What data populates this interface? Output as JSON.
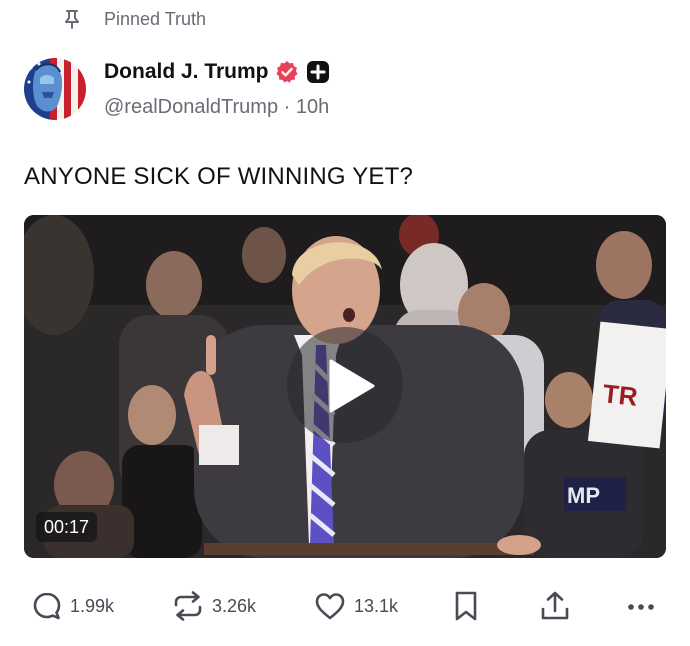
{
  "pinned": {
    "label": "Pinned Truth",
    "icon": "pin-icon"
  },
  "author": {
    "display_name": "Donald J. Trump",
    "handle": "@realDonaldTrump",
    "separator": "·",
    "time_ago": "10h",
    "verified_icon": "verified-badge-icon",
    "verified_color": "#e8415a",
    "badge_icon": "plus-badge-icon"
  },
  "post": {
    "text": "ANYONE SICK OF WINNING YET?"
  },
  "video": {
    "duration": "00:17",
    "play_icon": "play-icon"
  },
  "actions": {
    "replies": {
      "icon": "reply-icon",
      "count": "1.99k"
    },
    "retruths": {
      "icon": "retruth-icon",
      "count": "3.26k"
    },
    "likes": {
      "icon": "heart-icon",
      "count": "13.1k"
    },
    "bookmark": {
      "icon": "bookmark-icon"
    },
    "share": {
      "icon": "share-icon"
    },
    "more": {
      "icon": "more-icon"
    }
  },
  "colors": {
    "muted_text": "#6b6b75",
    "icon_gray": "#4a4a55",
    "accent": "#e8415a"
  }
}
